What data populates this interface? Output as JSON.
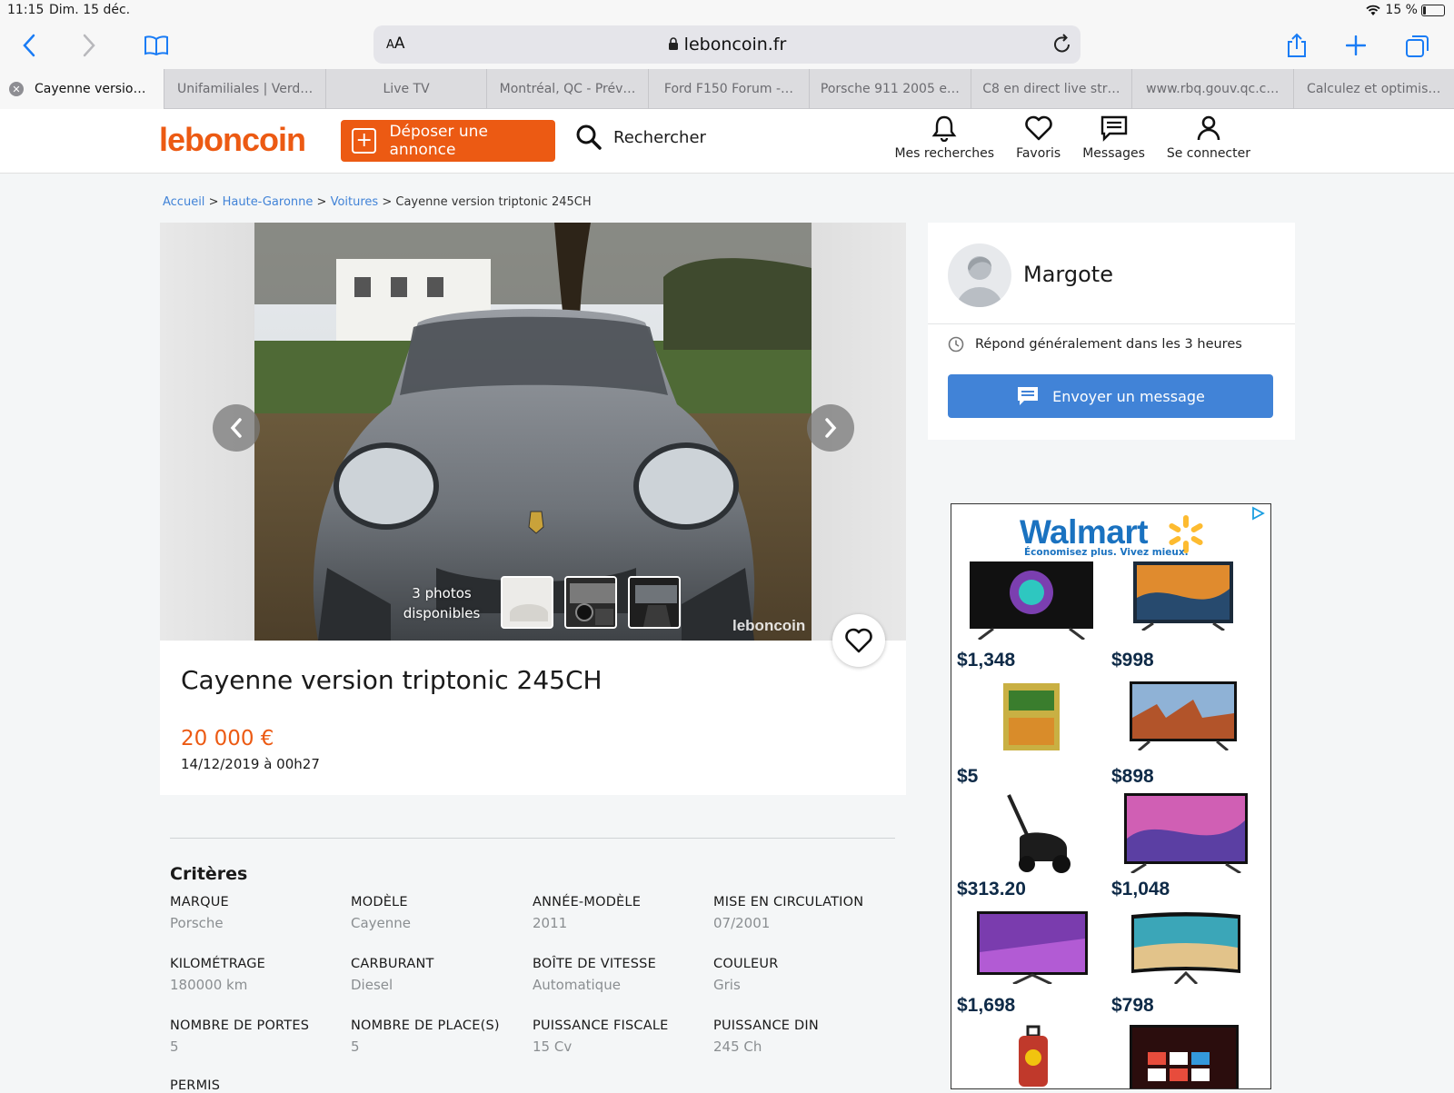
{
  "status": {
    "time": "11:15",
    "date": "Dim. 15 déc.",
    "battery": "15 %"
  },
  "browser": {
    "url": "leboncoin.fr",
    "text_size": "AA",
    "tabs": [
      "Cayenne versio…",
      "Unifamiliales | Verd…",
      "Live TV",
      "Montréal, QC - Prév…",
      "Ford F150 Forum -…",
      "Porsche 911 2005 e…",
      "C8 en direct live str…",
      "www.rbq.gouv.qc.c…",
      "Calculez et optimis…"
    ]
  },
  "site": {
    "logo": "leboncoin",
    "deposit_label": "Déposer une annonce",
    "search_label": "Rechercher",
    "nav": [
      {
        "label": "Mes recherches",
        "icon": "bell-icon"
      },
      {
        "label": "Favoris",
        "icon": "heart-icon"
      },
      {
        "label": "Messages",
        "icon": "message-icon"
      },
      {
        "label": "Se connecter",
        "icon": "user-icon"
      }
    ]
  },
  "breadcrumb": {
    "items": [
      "Accueil",
      "Haute-Garonne",
      "Voitures"
    ],
    "current": "Cayenne version triptonic 245CH",
    "sep": ">"
  },
  "gallery": {
    "photo_count_line1": "3 photos",
    "photo_count_line2": "disponibles",
    "watermark": "leboncoin"
  },
  "ad": {
    "title": "Cayenne version triptonic 245CH",
    "price": "20 000 €",
    "date": "14/12/2019 à 00h27"
  },
  "criteria": {
    "title": "Critères",
    "items": [
      {
        "key": "MARQUE",
        "value": "Porsche"
      },
      {
        "key": "MODÈLE",
        "value": "Cayenne"
      },
      {
        "key": "ANNÉE-MODÈLE",
        "value": "2011"
      },
      {
        "key": "MISE EN CIRCULATION",
        "value": "07/2001"
      },
      {
        "key": "KILOMÉTRAGE",
        "value": "180000 km"
      },
      {
        "key": "CARBURANT",
        "value": "Diesel"
      },
      {
        "key": "BOÎTE DE VITESSE",
        "value": "Automatique"
      },
      {
        "key": "COULEUR",
        "value": "Gris"
      },
      {
        "key": "NOMBRE DE PORTES",
        "value": "5"
      },
      {
        "key": "NOMBRE DE PLACE(S)",
        "value": "5"
      },
      {
        "key": "PUISSANCE FISCALE",
        "value": "15 Cv"
      },
      {
        "key": "PUISSANCE DIN",
        "value": "245 Ch"
      },
      {
        "key": "PERMIS",
        "value": ""
      }
    ]
  },
  "seller": {
    "name": "Margote",
    "response": "Répond généralement dans les 3 heures",
    "message_button": "Envoyer un message"
  },
  "walmart_ad": {
    "brand": "Walmart",
    "tagline": "Économisez plus. Vivez mieux.",
    "prices": [
      "$1,348",
      "$998",
      "$5",
      "$898",
      "$313.20",
      "$1,048",
      "$1,698",
      "$798"
    ]
  },
  "colors": {
    "brand_orange": "#ec5a13",
    "link_blue": "#4183d7",
    "walmart_blue": "#1a72c0",
    "walmart_yellow": "#fdbb30"
  }
}
